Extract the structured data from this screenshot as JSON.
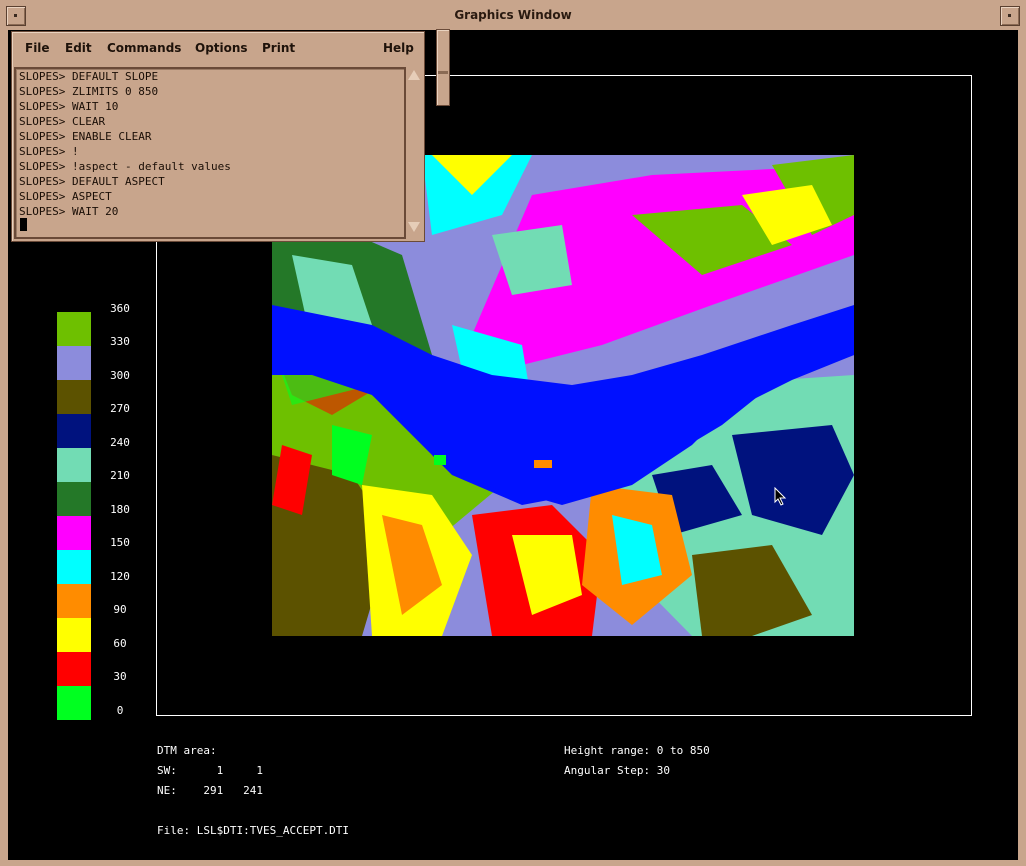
{
  "window": {
    "title": "Graphics Window"
  },
  "command_window": {
    "menus": [
      "File",
      "Edit",
      "Commands",
      "Options",
      "Print",
      "Help"
    ],
    "log": [
      "SLOPES> DEFAULT SLOPE",
      "SLOPES> ZLIMITS 0 850",
      "SLOPES> WAIT 10",
      "SLOPES> CLEAR",
      "SLOPES> ENABLE CLEAR",
      "SLOPES> !",
      "SLOPES> !aspect - default values",
      "SLOPES> DEFAULT ASPECT",
      "SLOPES> ASPECT",
      "SLOPES> WAIT 20"
    ]
  },
  "legend": {
    "labels": [
      "360",
      "330",
      "300",
      "270",
      "240",
      "210",
      "180",
      "150",
      "120",
      "90",
      "60",
      "30",
      "0"
    ],
    "colors": [
      "#6ec000",
      "#8c8cdc",
      "#5c5200",
      "#00127e",
      "#72dcb4",
      "#247828",
      "#ff00ff",
      "#00ffff",
      "#ff8c00",
      "#ffff00",
      "#ff0000",
      "#00ff20"
    ]
  },
  "info": {
    "dtm_area": "DTM area:",
    "sw": "SW:      1     1",
    "ne": "NE:    291   241",
    "file": "File: LSL$DTI:TVES_ACCEPT.DTI",
    "height_range": "Height range: 0 to 850",
    "angular_step": "Angular Step: 30"
  },
  "icons": {
    "window_menu": "window-menu-icon",
    "window_maximize": "maximize-icon",
    "scroll_up": "scroll-up-arrow-icon",
    "scroll_down": "scroll-down-arrow-icon",
    "mouse": "mouse-pointer-icon"
  }
}
